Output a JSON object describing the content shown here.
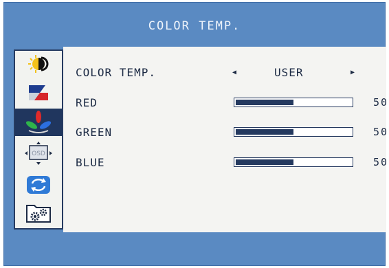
{
  "osd": {
    "title": "COLOR TEMP.",
    "colors": {
      "frame": "#5a8ac2",
      "panel": "#f4f4f2",
      "text": "#1c2a44",
      "bar_fill": "#24395f",
      "active_item": "#20365e"
    }
  },
  "sidebar": {
    "items": [
      {
        "icon": "brightness-contrast-icon",
        "active": false
      },
      {
        "icon": "image-adjust-icon",
        "active": false
      },
      {
        "icon": "color-temp-icon",
        "active": true
      },
      {
        "icon": "osd-settings-icon",
        "active": false
      },
      {
        "icon": "reset-icon",
        "active": false
      },
      {
        "icon": "misc-settings-icon",
        "active": false
      }
    ],
    "osd_icon_text": "OSD"
  },
  "color_temp": {
    "label": "COLOR TEMP.",
    "value": "USER",
    "left_arrow": "◀",
    "right_arrow": "▶"
  },
  "channels": [
    {
      "label": "RED",
      "value": "50",
      "level": 0.5
    },
    {
      "label": "GREEN",
      "value": "50",
      "level": 0.5
    },
    {
      "label": "BLUE",
      "value": "50",
      "level": 0.5
    }
  ]
}
